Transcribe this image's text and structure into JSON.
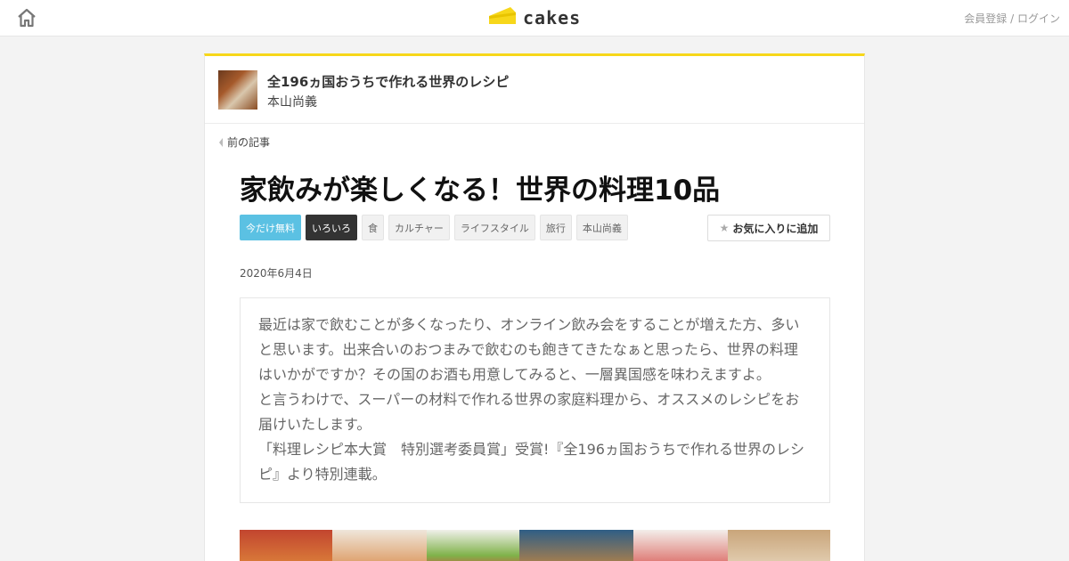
{
  "header": {
    "logo_text": "cakes",
    "signup": "会員登録",
    "separator": " / ",
    "login": "ログイン",
    "icons": {
      "home": "home-icon",
      "logo": "cake-logo-icon"
    },
    "accent_color": "#f7d71a"
  },
  "series": {
    "title": "全196ヵ国おうちで作れる世界のレシピ",
    "author": "本山尚義"
  },
  "nav": {
    "prev_label": "前の記事"
  },
  "article": {
    "title": "家飲みが楽しくなる！世界の料理10品",
    "date": "2020年6月4日",
    "tags": [
      {
        "label": "今だけ無料",
        "style": "free"
      },
      {
        "label": "いろいろ",
        "style": "dark"
      },
      {
        "label": "食",
        "style": "normal"
      },
      {
        "label": "カルチャー",
        "style": "normal"
      },
      {
        "label": "ライフスタイル",
        "style": "normal"
      },
      {
        "label": "旅行",
        "style": "normal"
      },
      {
        "label": "本山尚義",
        "style": "normal"
      }
    ],
    "favorite_label": "お気に入りに追加",
    "lead_lines": [
      "最近は家で飲むことが多くなったり、オンライン飲み会をすることが増えた方、多いと思います。出来合いのおつまみで飲むのも飽きてきたなぁと思ったら、世界の料理はいかがですか？その国のお酒も用意してみると、一層異国感を味わえますよ。",
      "と言うわけで、スーパーの材料で作れる世界の家庭料理から、オススメのレシピをお届けいたします。",
      "「料理レシピ本大賞　特別選考委員賞」受賞!『全196ヵ国おうちで作れる世界のレシピ』より特別連載。"
    ]
  }
}
